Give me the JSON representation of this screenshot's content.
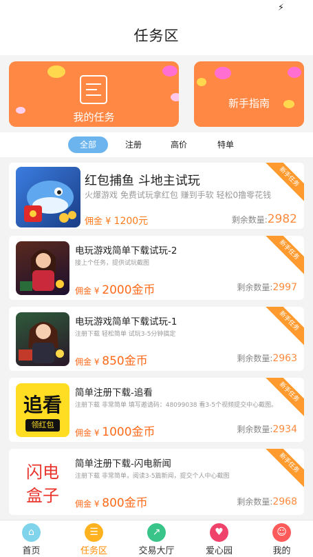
{
  "status_bar": {
    "icon": "lightning-icon"
  },
  "header": {
    "title": "任务区"
  },
  "banners": {
    "my_tasks": "我的任务",
    "guide": "新手指南",
    "color": "#ff8845"
  },
  "filters": [
    "全部",
    "注册",
    "高价",
    "特单"
  ],
  "tasks": [
    {
      "title": "红包捕鱼 斗地主试玩",
      "desc": "火爆游戏 免费试玩拿红包 赚到手软 轻松0撸零花钱",
      "reward_prefix": "佣金 ¥ ",
      "reward_amount": "1200元",
      "remain_label": "剩余数量:",
      "remain": "2982",
      "badge": "新手任务"
    },
    {
      "title": "电玩游戏简单下载试玩-2",
      "desc": "接上个任务，提供试玩截图",
      "reward_prefix": "佣金 ¥ ",
      "reward_amount": "2000金币",
      "remain_label": "剩余数量:",
      "remain": "2997",
      "badge": "新手任务"
    },
    {
      "title": "电玩游戏简单下载试玩-1",
      "desc": "注册下载 轻松简单 试玩3-5分钟搞定",
      "reward_prefix": "佣金 ¥ ",
      "reward_amount": "850金币",
      "remain_label": "剩余数量:",
      "remain": "2963",
      "badge": "新手任务"
    },
    {
      "title": "简单注册下载-追看",
      "desc": "注册下载 非常简单 填写邀请码：48099038 看3-5个视频提交中心截图。",
      "reward_prefix": "佣金 ¥ ",
      "reward_amount": "1000金币",
      "remain_label": "剩余数量:",
      "remain": "2934",
      "badge": "新手任务",
      "logo_text": "追看",
      "logo_sub": "领红包"
    },
    {
      "title": "简单注册下载-闪电新闻",
      "desc": "注册下载 非常简单，阅读3-5篇新闻，提交个人中心截图",
      "reward_prefix": "佣金 ¥ ",
      "reward_amount": "800金币",
      "remain_label": "剩余数量:",
      "remain": "2968",
      "badge": "新手任务",
      "logo_line1": "闪电",
      "logo_line2": "盒子"
    }
  ],
  "tabbar": [
    {
      "label": "首页",
      "icon": "home-icon",
      "color": "#7fd3ea"
    },
    {
      "label": "任务区",
      "icon": "coins-icon",
      "color": "#ffb21f"
    },
    {
      "label": "交易大厅",
      "icon": "chart-icon",
      "color": "#39c48a"
    },
    {
      "label": "爱心园",
      "icon": "heart-pulse-icon",
      "color": "#f0436c"
    },
    {
      "label": "我的",
      "icon": "user-icon",
      "color": "#ff5a5a"
    }
  ],
  "colors": {
    "accent": "#ff8845",
    "active_tab": "#6bb4ee",
    "price": "#ff6a1a",
    "ribbon": "#ff9a2e"
  }
}
